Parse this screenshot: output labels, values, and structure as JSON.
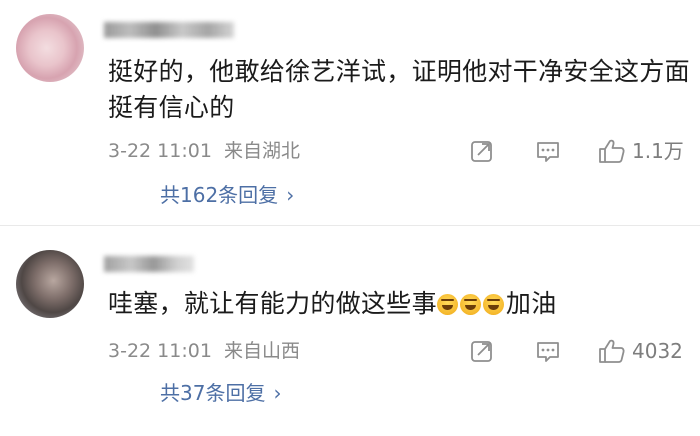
{
  "comments": [
    {
      "text": "挺好的，他敢给徐艺洋试，证明他对干净安全这方面挺有信心的",
      "time": "3-22 11:01",
      "location": "来自湖北",
      "likes": "1.1万",
      "replies": "共162条回复"
    },
    {
      "text_prefix": "哇塞，就让有能力的做这些事",
      "emoji_count": 3,
      "text_suffix": "加油",
      "time": "3-22 11:01",
      "location": "来自山西",
      "likes": "4032",
      "replies": "共37条回复"
    }
  ],
  "icons": {
    "share": "share-icon",
    "comment": "comment-icon",
    "like": "thumbs-up-icon",
    "emoji": "tears-of-joy-emoji"
  },
  "colors": {
    "link": "#4d6fa5",
    "meta": "#8a8a8a"
  }
}
